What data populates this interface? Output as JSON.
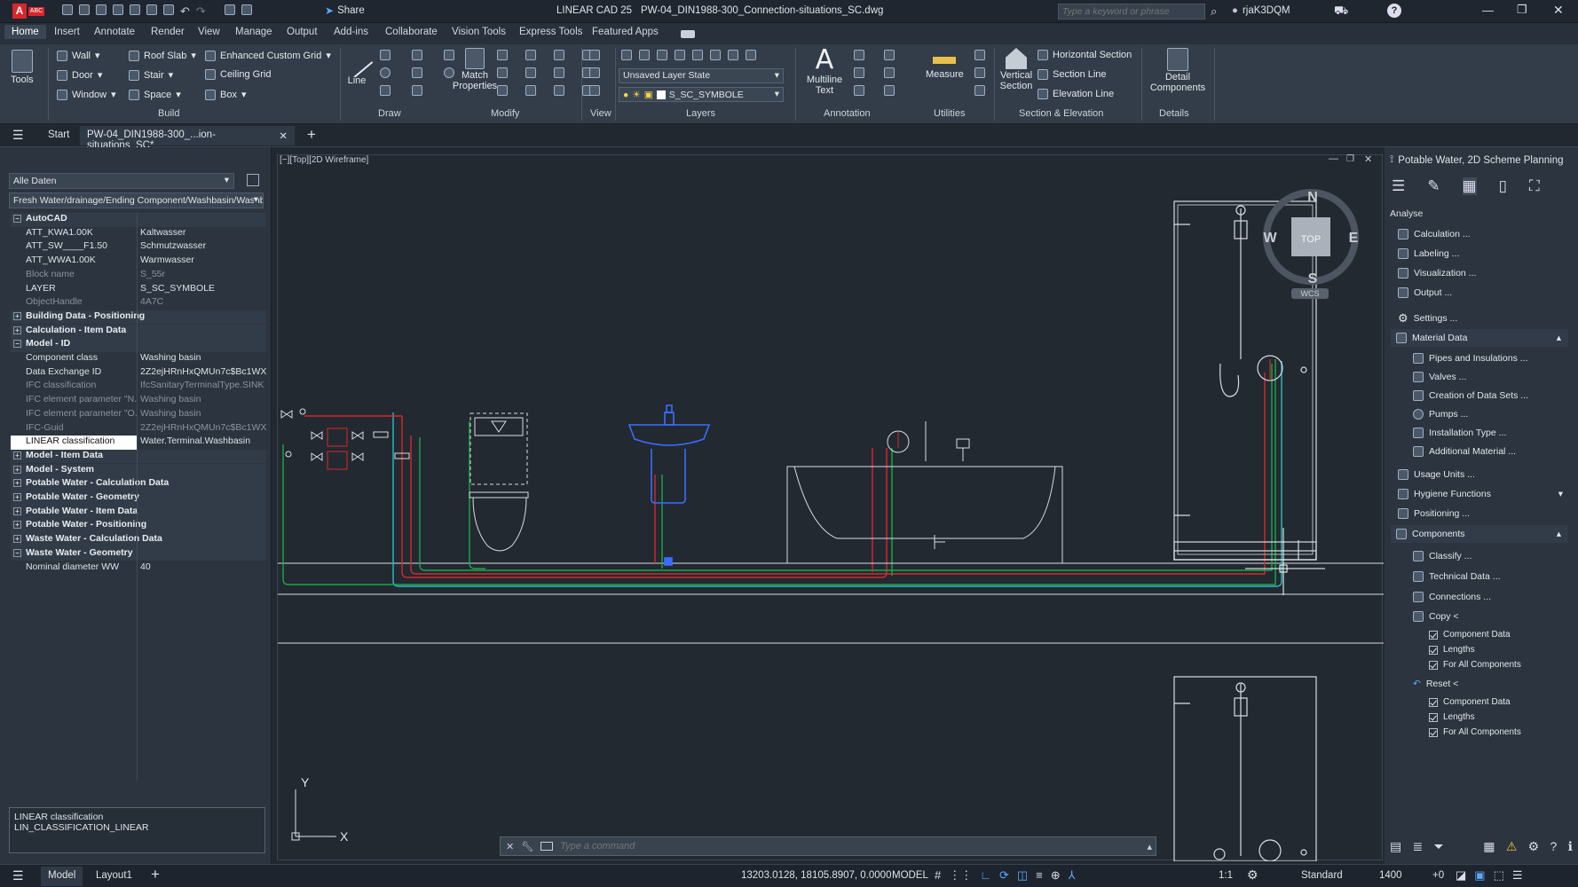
{
  "app": {
    "logo": "A",
    "badge": "ABC",
    "title": "LINEAR CAD 25",
    "file": "PW-04_DIN1988-300_Connection-situations_SC.dwg",
    "share": "Share",
    "search_placeholder": "Type a keyword or phrase",
    "user": "rjaK3DQM"
  },
  "ribbon_tabs": [
    "Home",
    "Insert",
    "Annotate",
    "Render",
    "View",
    "Manage",
    "Output",
    "Add-ins",
    "Collaborate",
    "Vision Tools",
    "Express Tools",
    "Featured Apps"
  ],
  "ribbon": {
    "tools": "Tools",
    "build": {
      "wall": "Wall",
      "door": "Door",
      "window": "Window",
      "roof_slab": "Roof Slab",
      "stair": "Stair",
      "space": "Space",
      "grid": "Enhanced Custom Grid",
      "ceiling_grid": "Ceiling Grid",
      "box": "Box",
      "label": "Build"
    },
    "draw": {
      "line": "Line",
      "label": "Draw"
    },
    "modify": {
      "match": "Match Properties",
      "label": "Modify"
    },
    "view_label": "View",
    "layers": {
      "state": "Unsaved Layer State",
      "layer": "S_SC_SYMBOLE",
      "label": "Layers"
    },
    "annotation": {
      "mtext": "Multiline Text",
      "label": "Annotation"
    },
    "utilities": {
      "measure": "Measure",
      "label": "Utilities"
    },
    "section": {
      "vertical": "Vertical Section",
      "horizontal": "Horizontal Section",
      "section_line": "Section Line",
      "elevation_line": "Elevation Line",
      "label": "Section & Elevation"
    },
    "details": {
      "detail_components": "Detail Components",
      "label": "Details"
    }
  },
  "doc_tabs": {
    "start": "Start",
    "active": "PW-04_DIN1988-300_...ion-situations_SC*"
  },
  "properties": {
    "filter": "Alle Daten",
    "component": "Fresh Water/drainage/Ending Component/Washbasin/Washb",
    "rows": [
      {
        "type": "cat",
        "label": "AutoCAD",
        "sign": "−"
      },
      {
        "type": "row",
        "k": "ATT_KWA1.00K",
        "v": "Kaltwasser"
      },
      {
        "type": "row",
        "k": "ATT_SW____F1.50",
        "v": "Schmutzwasser"
      },
      {
        "type": "row",
        "k": "ATT_WWA1.00K",
        "v": "Warmwasser"
      },
      {
        "type": "grey",
        "k": "Block name",
        "v": "S_55r"
      },
      {
        "type": "row",
        "k": "LAYER",
        "v": "S_SC_SYMBOLE"
      },
      {
        "type": "grey",
        "k": "ObjectHandle",
        "v": "4A7C"
      },
      {
        "type": "cat",
        "label": "Building Data - Positioning",
        "sign": "+"
      },
      {
        "type": "cat",
        "label": "Calculation - Item Data",
        "sign": "+"
      },
      {
        "type": "cat",
        "label": "Model - ID",
        "sign": "−"
      },
      {
        "type": "row",
        "k": "Component class",
        "v": "Washing basin"
      },
      {
        "type": "row",
        "k": "Data Exchange ID",
        "v": "2Z2ejHRnHxQMUn7c$Bc1WX"
      },
      {
        "type": "grey",
        "k": "IFC classification",
        "v": "IfcSanitaryTerminalType.SINK"
      },
      {
        "type": "grey",
        "k": "IFC element parameter \"N...",
        "v": "Washing basin"
      },
      {
        "type": "grey",
        "k": "IFC element parameter \"O...",
        "v": "Washing basin"
      },
      {
        "type": "grey",
        "k": "IFC-Guid",
        "v": "2Z2ejHRnHxQMUn7c$Bc1WX"
      },
      {
        "type": "sel",
        "k": "LINEAR classification",
        "v": "Water.Terminal.Washbasin"
      },
      {
        "type": "cat",
        "label": "Model - Item Data",
        "sign": "+"
      },
      {
        "type": "cat",
        "label": "Model - System",
        "sign": "+"
      },
      {
        "type": "cat",
        "label": "Potable Water - Calculation Data",
        "sign": "+"
      },
      {
        "type": "cat",
        "label": "Potable Water - Geometry",
        "sign": "+"
      },
      {
        "type": "cat",
        "label": "Potable Water - Item Data",
        "sign": "+"
      },
      {
        "type": "cat",
        "label": "Potable Water - Positioning",
        "sign": "+"
      },
      {
        "type": "cat",
        "label": "Waste Water - Calculation Data",
        "sign": "+"
      },
      {
        "type": "cat",
        "label": "Waste Water - Geometry",
        "sign": "−"
      },
      {
        "type": "row",
        "k": "Nominal diameter WW",
        "v": "40"
      }
    ],
    "desc_title": "LINEAR classification",
    "desc_value": "LIN_CLASSIFICATION_LINEAR"
  },
  "viewport": {
    "label": "[−][Top][2D Wireframe]",
    "cube": {
      "n": "N",
      "s": "S",
      "e": "E",
      "w": "W",
      "top": "TOP",
      "wcs": "WCS"
    },
    "ucs_x": "X",
    "ucs_y": "Y"
  },
  "command": {
    "placeholder": "Type a command"
  },
  "right_panel": {
    "title": "Potable Water, 2D Scheme Planning",
    "analyse": "Analyse",
    "items": {
      "calculation": "Calculation ...",
      "labeling": "Labeling ...",
      "visualization": "Visualization ...",
      "output": "Output ...",
      "settings": "Settings ..."
    },
    "material_data": "Material Data",
    "material_items": [
      "Pipes and Insulations ...",
      "Valves ...",
      "Creation of Data Sets ...",
      "Pumps ...",
      "Installation Type ...",
      "Additional Material ..."
    ],
    "usage_units": "Usage Units ...",
    "hygiene": "Hygiene Functions",
    "positioning": "Positioning ...",
    "components": "Components",
    "component_items": [
      "Classify ...",
      "Technical Data ...",
      "Connections ..."
    ],
    "copy": "Copy <",
    "copy_checks": [
      "Component Data",
      "Lengths",
      "For All Components"
    ],
    "reset": "Reset <",
    "reset_checks": [
      "Component Data",
      "Lengths",
      "For All Components"
    ]
  },
  "status": {
    "model": "Model",
    "layout": "Layout1",
    "coords": "13203.0128, 18105.8907, 0.0000",
    "space": "MODEL",
    "scale": "1:1",
    "style": "Standard",
    "value": "1400",
    "plus": "+0"
  },
  "colors": {
    "cold": "#1aa84a",
    "hot": "#d8282c",
    "waste": "#2fb9c4",
    "selected": "#3a6dff",
    "white": "#d9dde2"
  }
}
